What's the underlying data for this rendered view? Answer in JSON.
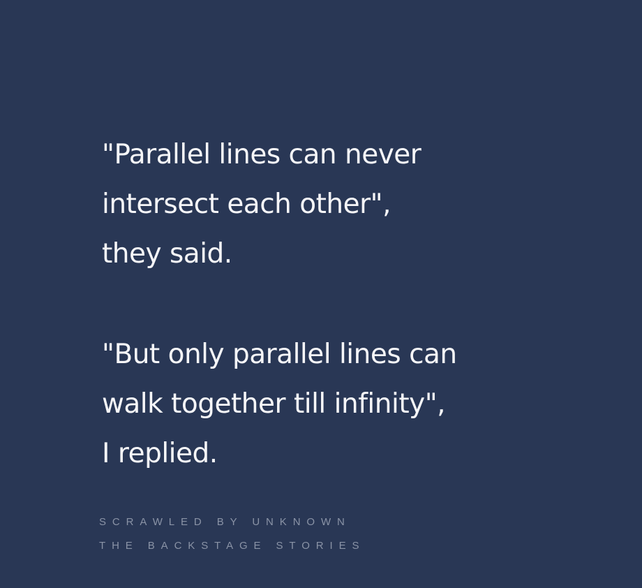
{
  "quote": {
    "stanza1": [
      "\"Parallel lines can never",
      "intersect each other\",",
      "they said."
    ],
    "stanza2": [
      "\"But only parallel lines can",
      "walk together till infinity\",",
      "I replied."
    ]
  },
  "credits": {
    "author": "SCRAWLED BY UNKNOWN",
    "source": "THE BACKSTAGE STORIES"
  },
  "colors": {
    "background": "#293755",
    "text": "#f6f6f8",
    "credit_text": "#8a93a6"
  }
}
